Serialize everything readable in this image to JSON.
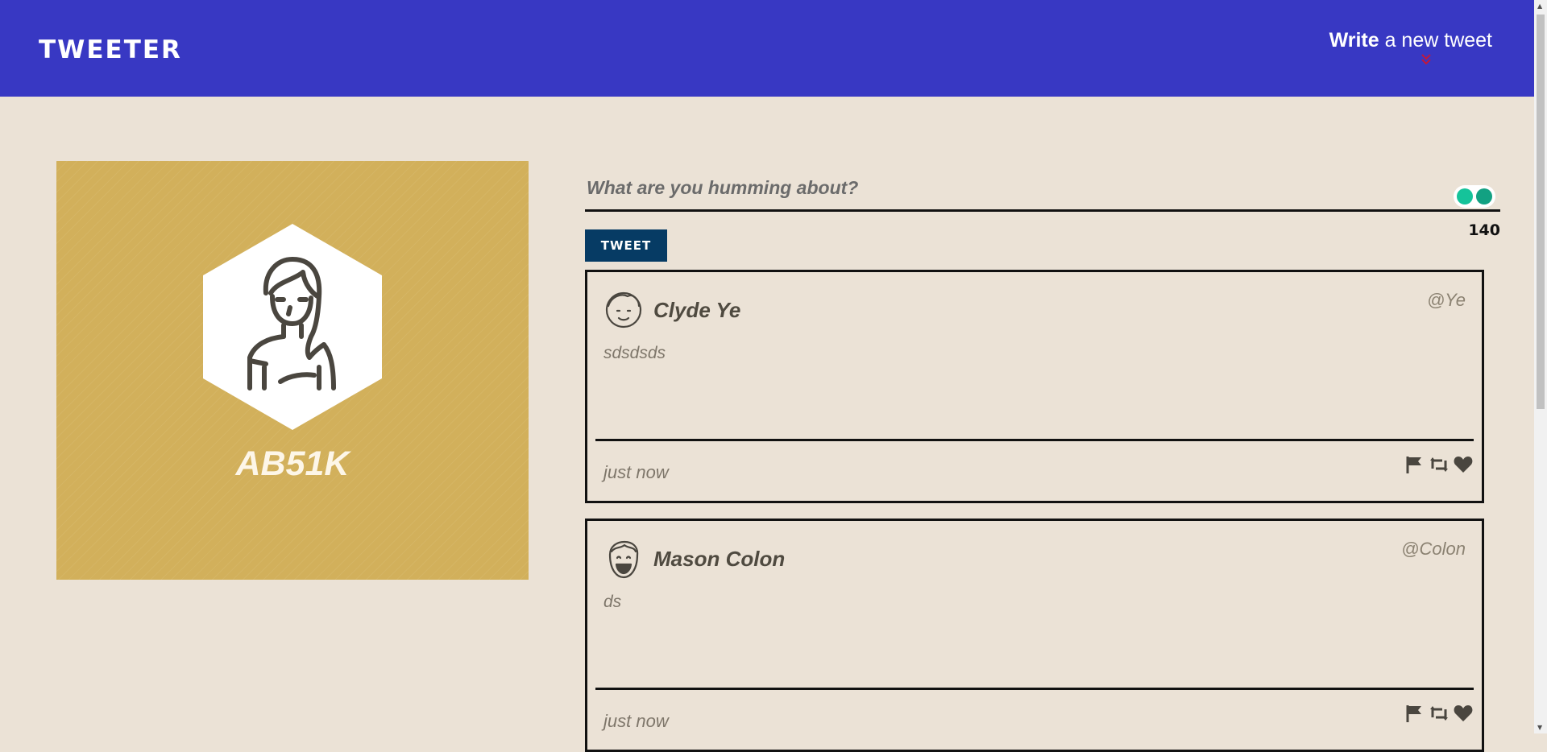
{
  "nav": {
    "brand": "TWEETER",
    "compose_bold": "Write",
    "compose_rest": " a new tweet"
  },
  "profile": {
    "handle": "AB51K",
    "avatar_icon": "woman-avatar-icon",
    "background_color": "#d2b05b"
  },
  "composer": {
    "placeholder": "What are you humming about?",
    "value": "",
    "button_label": "TWEET",
    "char_count": "140"
  },
  "tweets": [
    {
      "avatar_icon": "boy-avatar-icon",
      "name": "Clyde Ye",
      "handle": "@Ye",
      "content": "sdsdsds",
      "timestamp": "just now"
    },
    {
      "avatar_icon": "laughing-man-avatar-icon",
      "name": "Mason Colon",
      "handle": "@Colon",
      "content": "ds",
      "timestamp": "just now"
    }
  ],
  "colors": {
    "nav": "#3838c3",
    "page": "#ebe2d6",
    "tweet_button": "#063b64",
    "grammarly": "#15c39a"
  }
}
